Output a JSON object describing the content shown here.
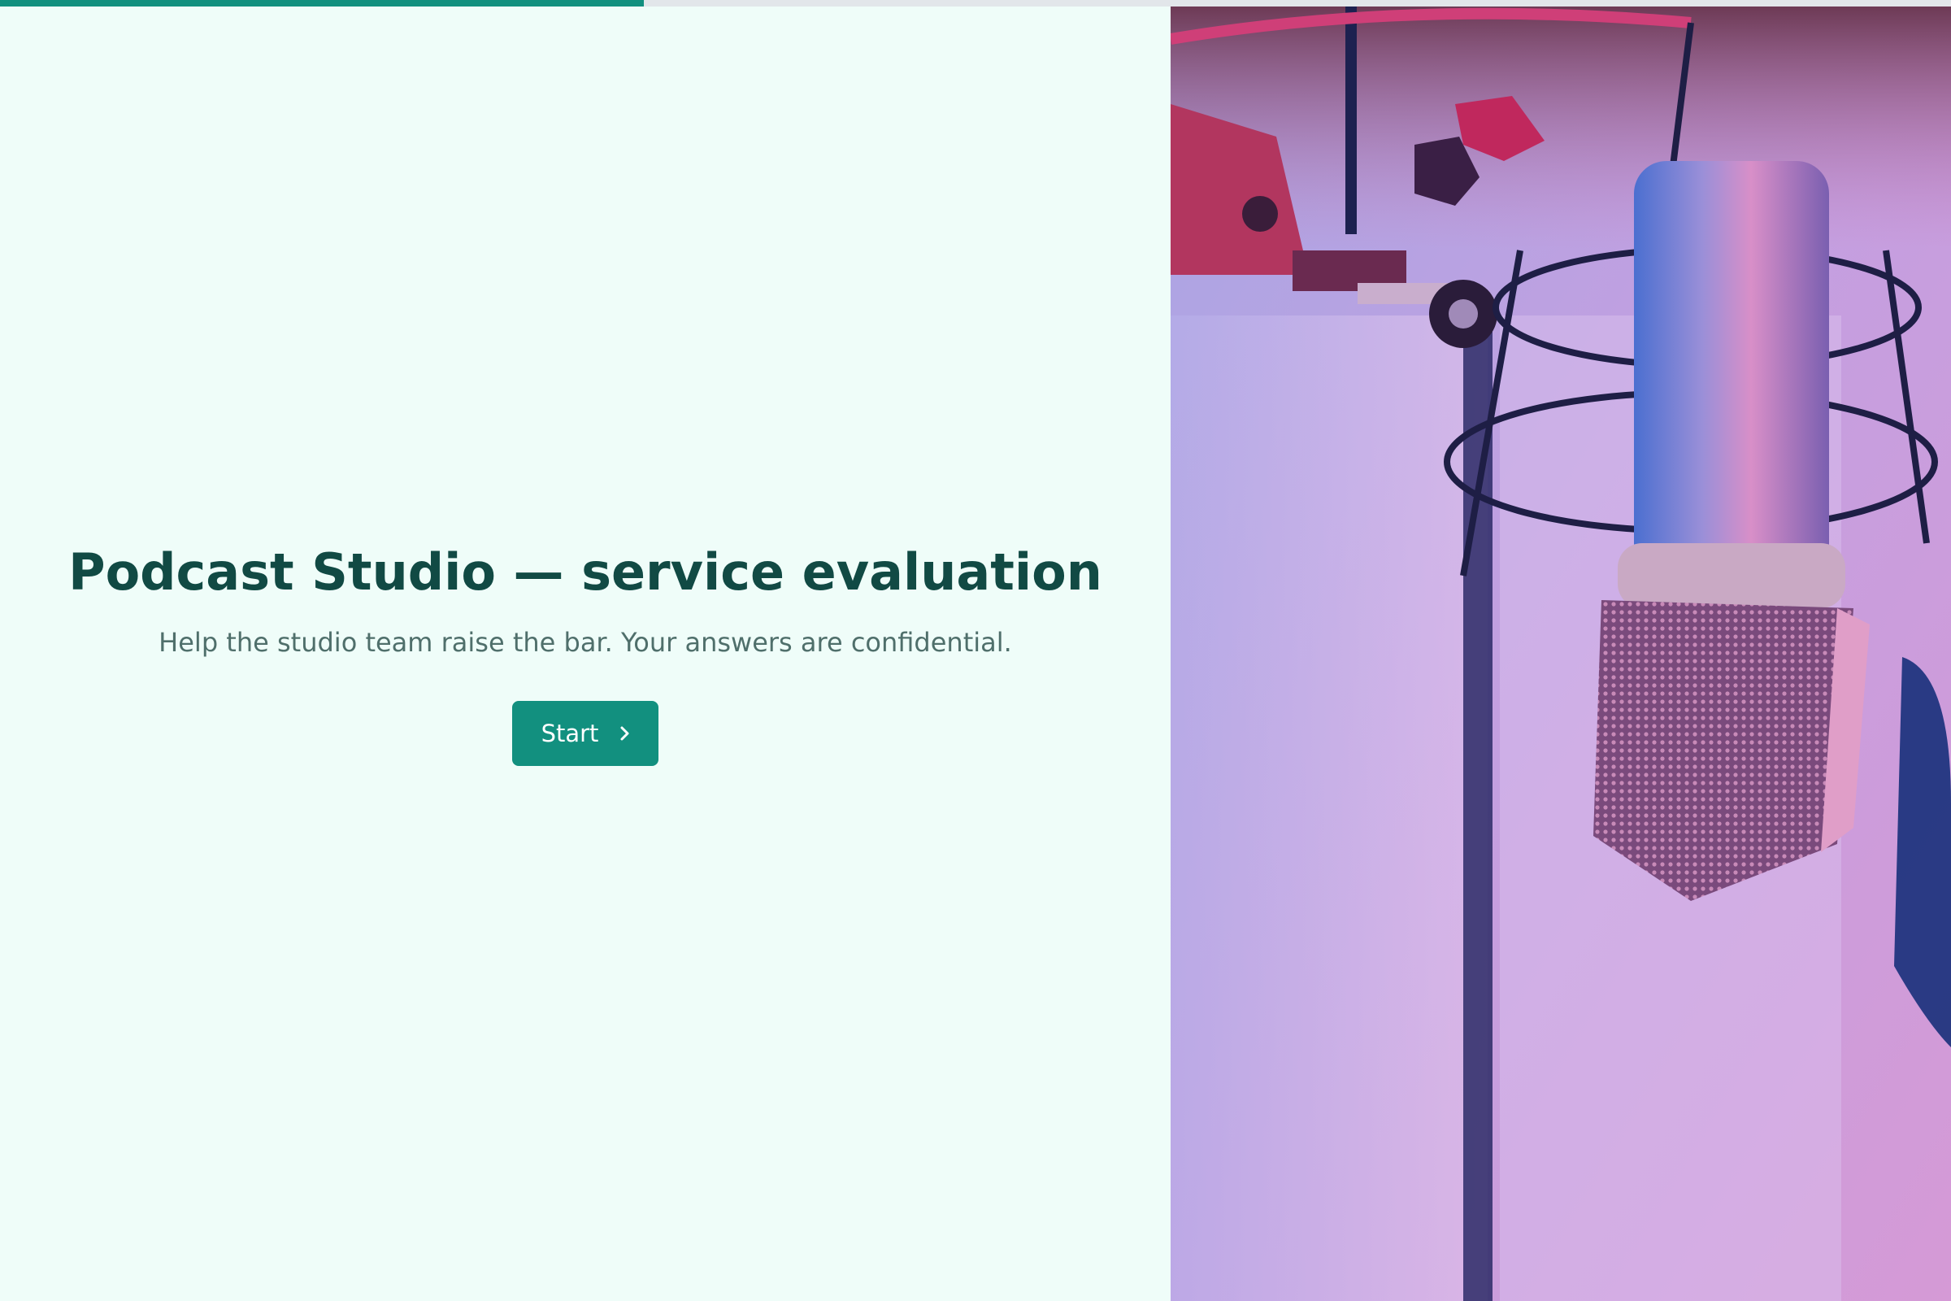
{
  "progress": {
    "value": 0.33,
    "fill_color": "#12907f",
    "track_color": "#e2e6ea"
  },
  "welcome": {
    "title": "Podcast Studio — service evaluation",
    "subtitle": "Help the studio team raise the bar. Your answers are confidential.",
    "start_label": "Start",
    "start_icon": "chevron-right-icon"
  },
  "colors": {
    "background": "#effdf9",
    "title": "#114a44",
    "subtitle": "#4f6f6b",
    "accent": "#12907f"
  },
  "image": {
    "subject": "studio-microphone-photo"
  }
}
